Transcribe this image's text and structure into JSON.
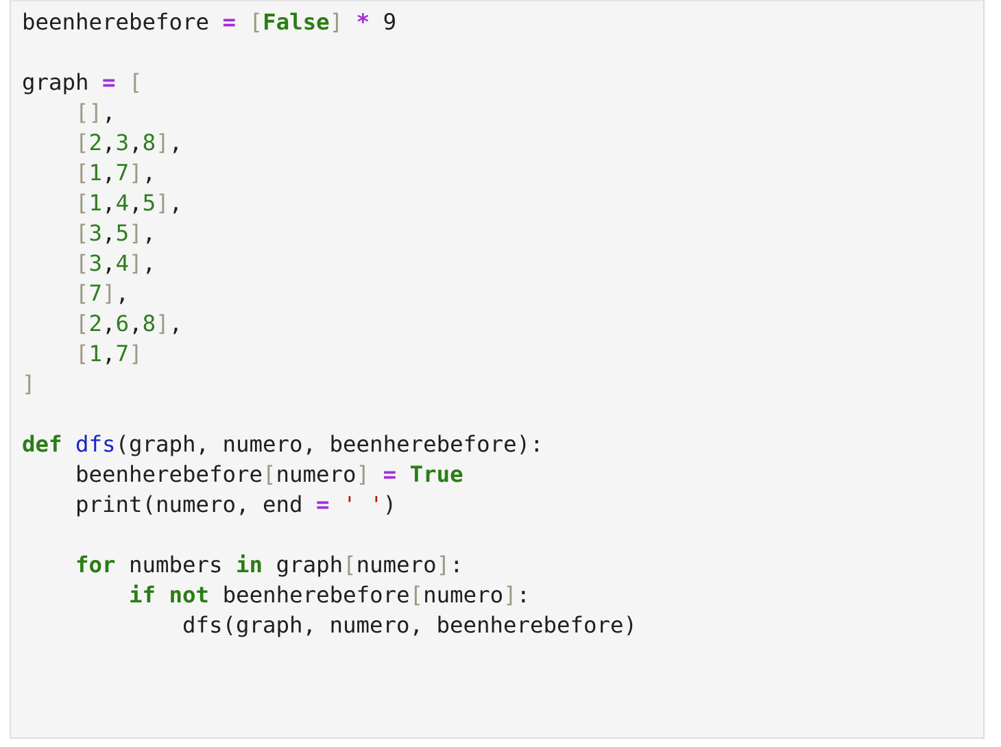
{
  "code": {
    "language": "python",
    "lines": [
      [
        [
          "t",
          "beenherebefore "
        ],
        [
          "op",
          "="
        ],
        [
          "t",
          " "
        ],
        [
          "br",
          "["
        ],
        [
          "kw",
          "False"
        ],
        [
          "br",
          "]"
        ],
        [
          "t",
          " "
        ],
        [
          "op",
          "*"
        ],
        [
          "t",
          " 9"
        ]
      ],
      [],
      [
        [
          "t",
          "graph "
        ],
        [
          "op",
          "="
        ],
        [
          "t",
          " "
        ],
        [
          "br",
          "["
        ]
      ],
      [
        [
          "t",
          "    "
        ],
        [
          "br",
          "[]"
        ],
        [
          "t",
          ","
        ]
      ],
      [
        [
          "t",
          "    "
        ],
        [
          "br",
          "["
        ],
        [
          "num",
          "2"
        ],
        [
          "t",
          ","
        ],
        [
          "num",
          "3"
        ],
        [
          "t",
          ","
        ],
        [
          "num",
          "8"
        ],
        [
          "br",
          "]"
        ],
        [
          "t",
          ","
        ]
      ],
      [
        [
          "t",
          "    "
        ],
        [
          "br",
          "["
        ],
        [
          "num",
          "1"
        ],
        [
          "t",
          ","
        ],
        [
          "num",
          "7"
        ],
        [
          "br",
          "]"
        ],
        [
          "t",
          ","
        ]
      ],
      [
        [
          "t",
          "    "
        ],
        [
          "br",
          "["
        ],
        [
          "num",
          "1"
        ],
        [
          "t",
          ","
        ],
        [
          "num",
          "4"
        ],
        [
          "t",
          ","
        ],
        [
          "num",
          "5"
        ],
        [
          "br",
          "]"
        ],
        [
          "t",
          ","
        ]
      ],
      [
        [
          "t",
          "    "
        ],
        [
          "br",
          "["
        ],
        [
          "num",
          "3"
        ],
        [
          "t",
          ","
        ],
        [
          "num",
          "5"
        ],
        [
          "br",
          "]"
        ],
        [
          "t",
          ","
        ]
      ],
      [
        [
          "t",
          "    "
        ],
        [
          "br",
          "["
        ],
        [
          "num",
          "3"
        ],
        [
          "t",
          ","
        ],
        [
          "num",
          "4"
        ],
        [
          "br",
          "]"
        ],
        [
          "t",
          ","
        ]
      ],
      [
        [
          "t",
          "    "
        ],
        [
          "br",
          "["
        ],
        [
          "num",
          "7"
        ],
        [
          "br",
          "]"
        ],
        [
          "t",
          ","
        ]
      ],
      [
        [
          "t",
          "    "
        ],
        [
          "br",
          "["
        ],
        [
          "num",
          "2"
        ],
        [
          "t",
          ","
        ],
        [
          "num",
          "6"
        ],
        [
          "t",
          ","
        ],
        [
          "num",
          "8"
        ],
        [
          "br",
          "]"
        ],
        [
          "t",
          ","
        ]
      ],
      [
        [
          "t",
          "    "
        ],
        [
          "br",
          "["
        ],
        [
          "num",
          "1"
        ],
        [
          "t",
          ","
        ],
        [
          "num",
          "7"
        ],
        [
          "br",
          "]"
        ]
      ],
      [
        [
          "br",
          "]"
        ]
      ],
      [],
      [
        [
          "kw",
          "def"
        ],
        [
          "t",
          " "
        ],
        [
          "fn",
          "dfs"
        ],
        [
          "t",
          "(graph, numero, beenherebefore):"
        ]
      ],
      [
        [
          "t",
          "    beenherebefore"
        ],
        [
          "br",
          "["
        ],
        [
          "t",
          "numero"
        ],
        [
          "br",
          "]"
        ],
        [
          "t",
          " "
        ],
        [
          "op",
          "="
        ],
        [
          "t",
          " "
        ],
        [
          "kw",
          "True"
        ]
      ],
      [
        [
          "t",
          "    print(numero, end "
        ],
        [
          "op",
          "="
        ],
        [
          "t",
          " "
        ],
        [
          "str",
          "' '"
        ],
        [
          "t",
          ")"
        ]
      ],
      [],
      [
        [
          "t",
          "    "
        ],
        [
          "kw",
          "for"
        ],
        [
          "t",
          " numbers "
        ],
        [
          "kw",
          "in"
        ],
        [
          "t",
          " graph"
        ],
        [
          "br",
          "["
        ],
        [
          "t",
          "numero"
        ],
        [
          "br",
          "]"
        ],
        [
          "t",
          ":"
        ]
      ],
      [
        [
          "t",
          "        "
        ],
        [
          "kw",
          "if"
        ],
        [
          "t",
          " "
        ],
        [
          "kw",
          "not"
        ],
        [
          "t",
          " beenherebefore"
        ],
        [
          "br",
          "["
        ],
        [
          "t",
          "numero"
        ],
        [
          "br",
          "]"
        ],
        [
          "t",
          ":"
        ]
      ],
      [
        [
          "t",
          "            dfs(graph, numero, beenherebefore)"
        ]
      ]
    ]
  },
  "colors": {
    "background": "#f5f5f5",
    "text": "#1f1f1f",
    "operator": "#a22fd6",
    "bracket": "#9a9a84",
    "number": "#2e7d1e",
    "keyword": "#2a7d16",
    "function_name": "#1a22c8",
    "string": "#b21818"
  }
}
